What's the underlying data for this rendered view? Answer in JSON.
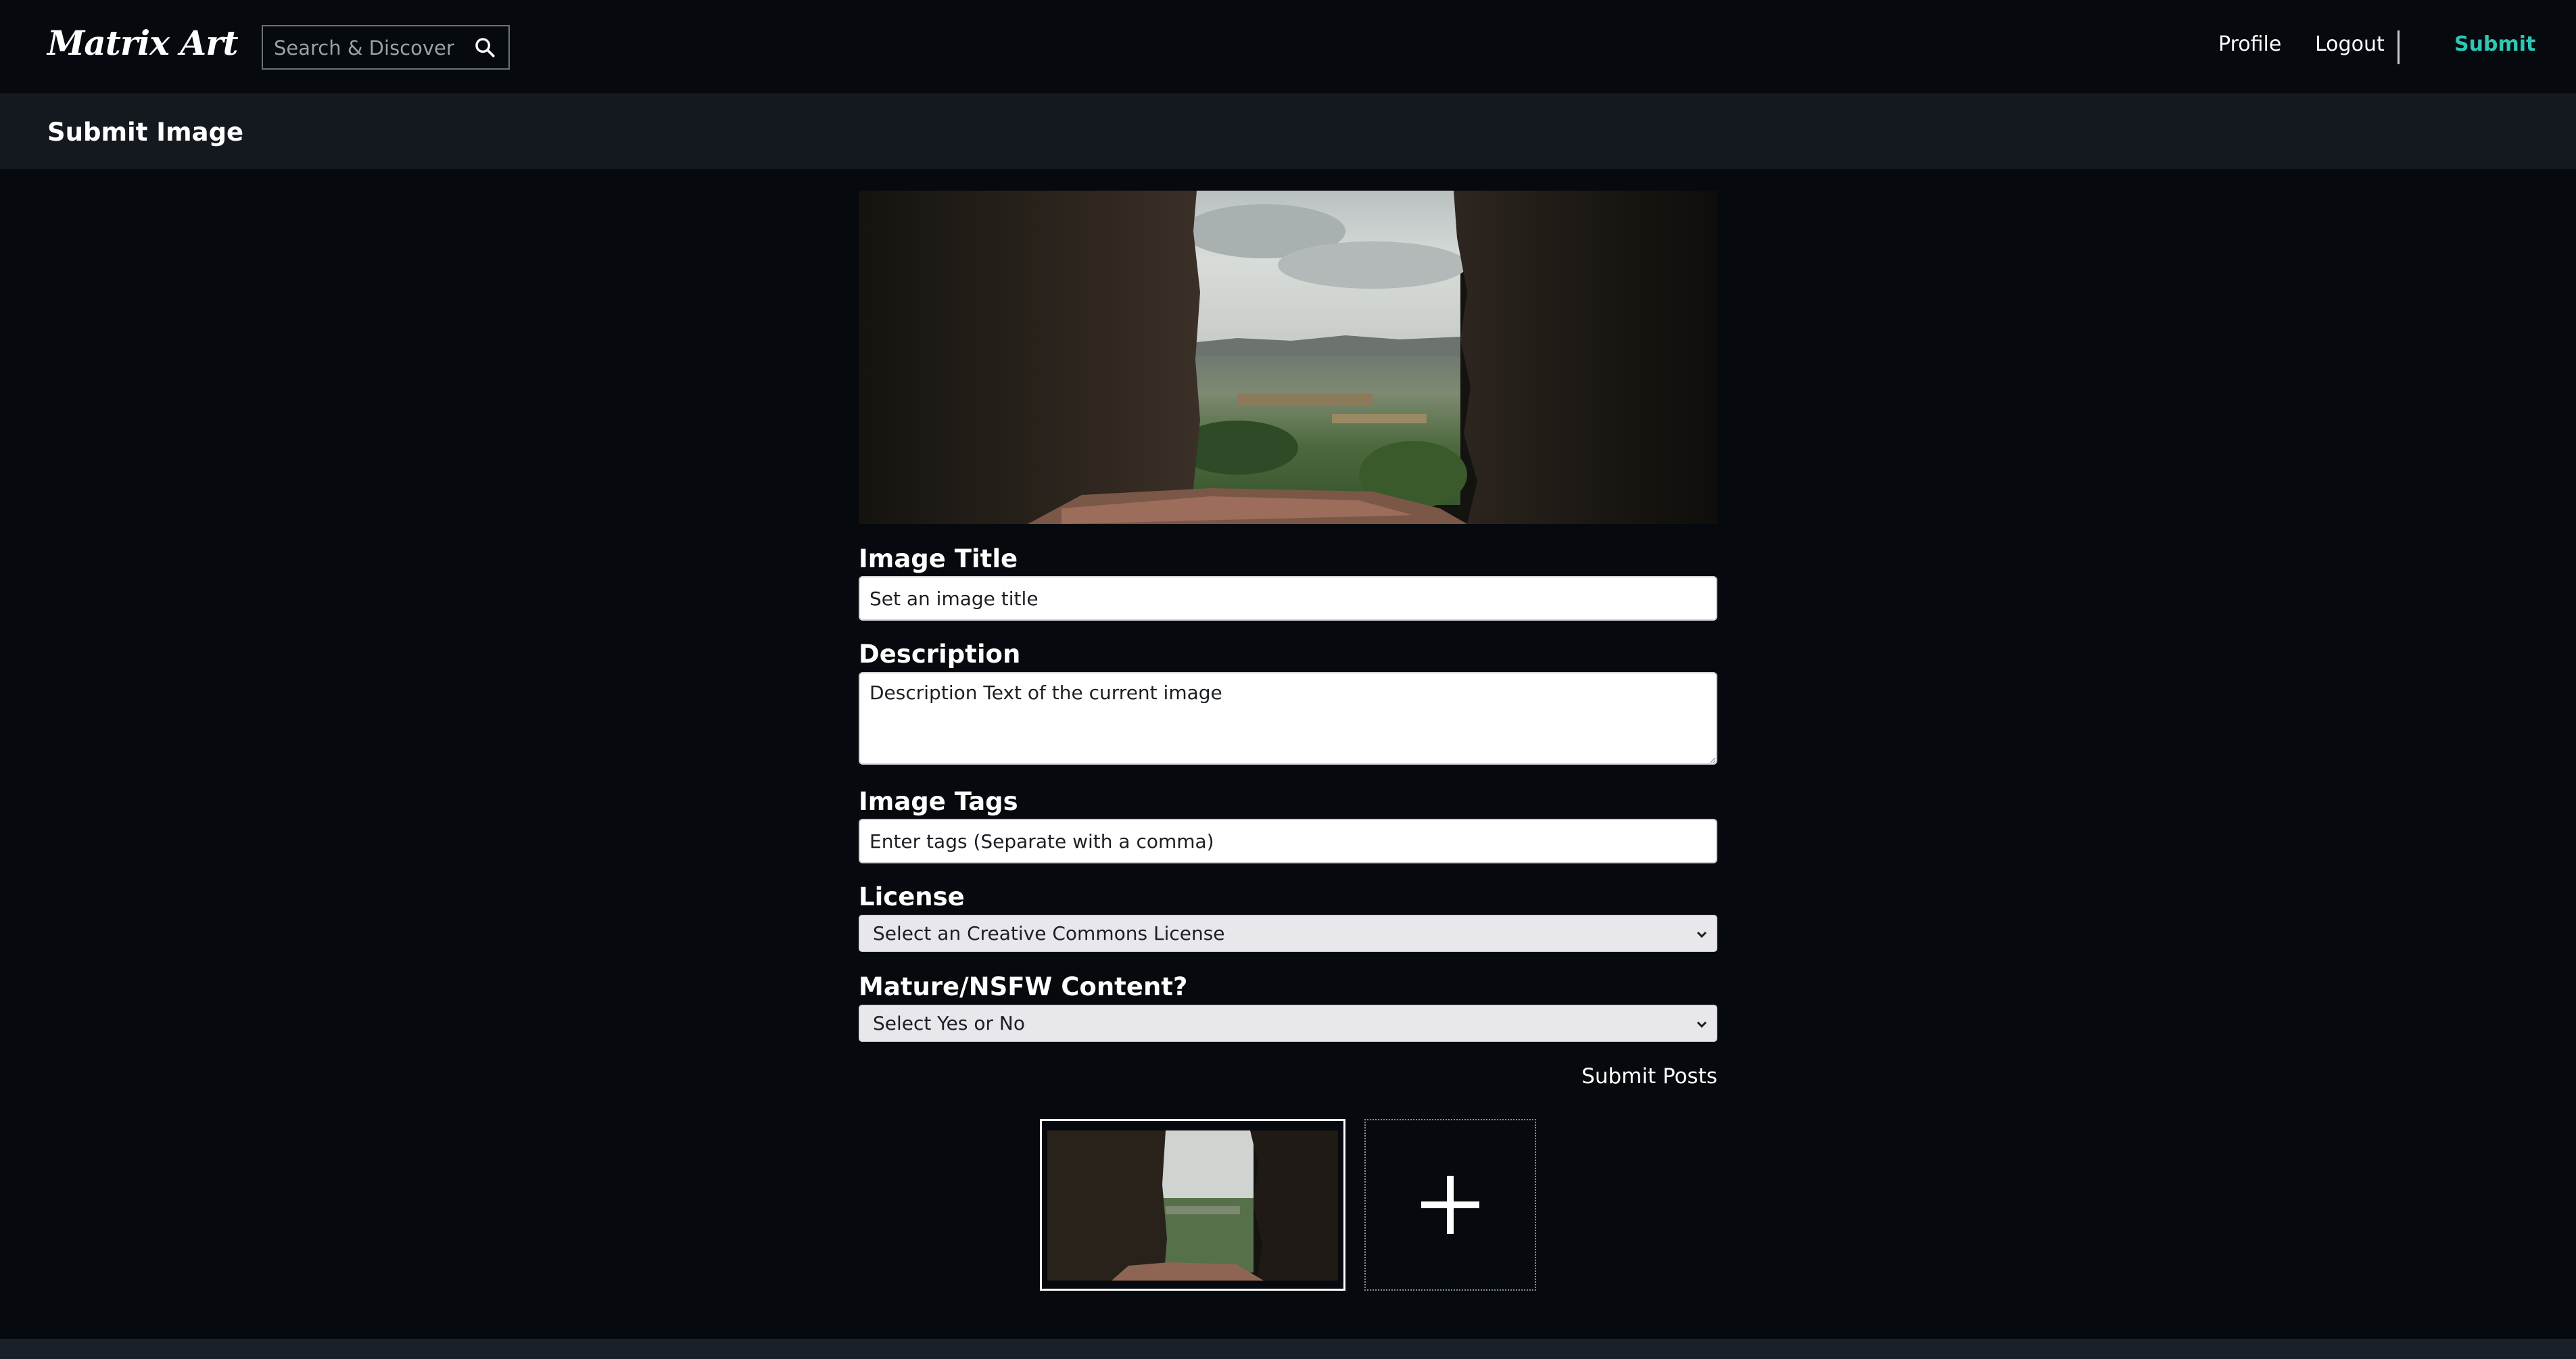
{
  "app": {
    "logo_text": "Matrix Art"
  },
  "search": {
    "placeholder": "Search & Discover",
    "icon": "search-icon"
  },
  "nav": {
    "profile_label": "Profile",
    "logout_label": "Logout",
    "submit_label": "Submit",
    "accent_color": "#2ec7b4"
  },
  "page": {
    "title": "Submit Image"
  },
  "form": {
    "title_label": "Image Title",
    "title_value": "Set an image title",
    "description_label": "Description",
    "description_value": "Description Text of the current image",
    "tags_label": "Image Tags",
    "tags_value": "Enter tags (Separate with a comma)",
    "license_label": "License",
    "license_selected": "Select an Creative Commons License",
    "nsfw_label": "Mature/NSFW Content?",
    "nsfw_selected": "Select Yes or No",
    "submit_posts_label": "Submit Posts"
  },
  "thumbnails": {
    "selected_icon": "landscape-window-image",
    "add_icon": "plus-icon"
  }
}
